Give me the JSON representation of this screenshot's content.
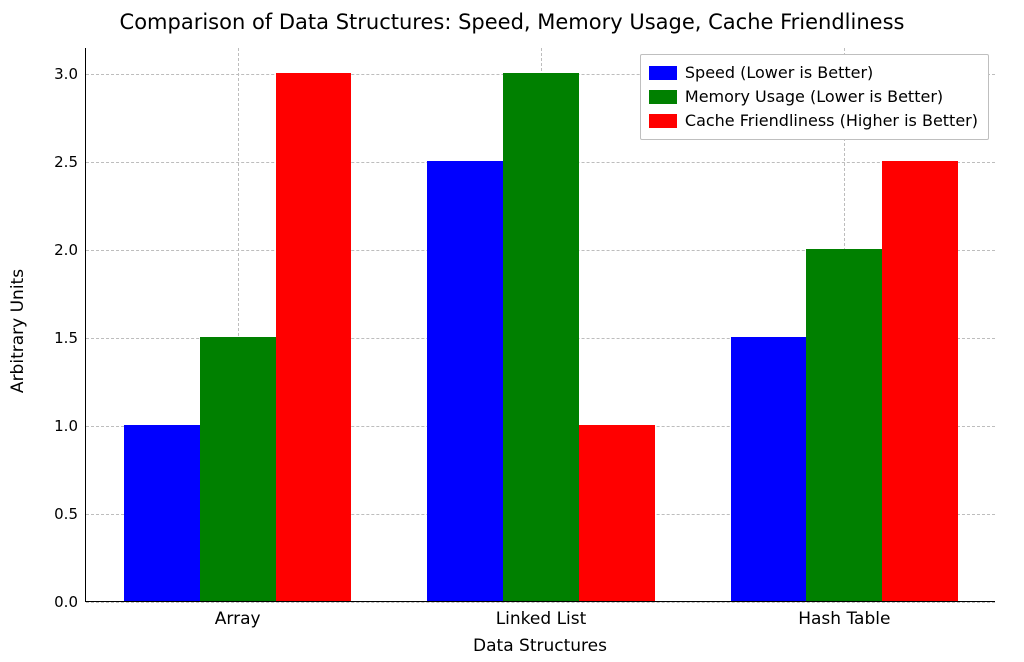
{
  "chart_data": {
    "type": "bar",
    "title": "Comparison of Data Structures: Speed, Memory Usage, Cache Friendliness",
    "xlabel": "Data Structures",
    "ylabel": "Arbitrary Units",
    "categories": [
      "Array",
      "Linked List",
      "Hash Table"
    ],
    "series": [
      {
        "name": "Speed (Lower is Better)",
        "color": "#0000ff",
        "values": [
          1.0,
          2.5,
          1.5
        ]
      },
      {
        "name": "Memory Usage (Lower is Better)",
        "color": "#008000",
        "values": [
          1.5,
          3.0,
          2.0
        ]
      },
      {
        "name": "Cache Friendliness (Higher is Better)",
        "color": "#ff0000",
        "values": [
          3.0,
          1.0,
          2.5
        ]
      }
    ],
    "ylim": [
      0.0,
      3.15
    ],
    "yticks": [
      0.0,
      0.5,
      1.0,
      1.5,
      2.0,
      2.5,
      3.0
    ],
    "ytick_labels": [
      "0.0",
      "0.5",
      "1.0",
      "1.5",
      "2.0",
      "2.5",
      "3.0"
    ],
    "legend_position": "upper-right",
    "grid": true,
    "bar_width": 0.25
  }
}
